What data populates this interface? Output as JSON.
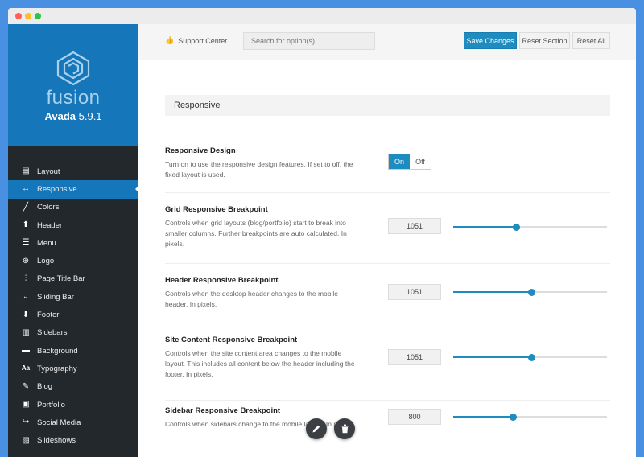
{
  "window": {
    "dots": [
      "#ff5f57",
      "#ffbd2e",
      "#28c940"
    ]
  },
  "brand": {
    "name": "fusion",
    "product": "Avada",
    "version": "5.9.1"
  },
  "sidebar": {
    "items": [
      {
        "label": "Layout",
        "icon": "layout-icon",
        "glyph": "▤",
        "active": false
      },
      {
        "label": "Responsive",
        "icon": "arrows-horizontal-icon",
        "glyph": "↔",
        "active": true
      },
      {
        "label": "Colors",
        "icon": "brush-icon",
        "glyph": "╱",
        "active": false
      },
      {
        "label": "Header",
        "icon": "arrow-up-icon",
        "glyph": "⬆",
        "active": false
      },
      {
        "label": "Menu",
        "icon": "menu-icon",
        "glyph": "☰",
        "active": false
      },
      {
        "label": "Logo",
        "icon": "plus-circle-icon",
        "glyph": "⊕",
        "active": false
      },
      {
        "label": "Page Title Bar",
        "icon": "sliders-icon",
        "glyph": "⫶",
        "active": false
      },
      {
        "label": "Sliding Bar",
        "icon": "chevron-down-icon",
        "glyph": "⌄",
        "active": false
      },
      {
        "label": "Footer",
        "icon": "arrow-down-icon",
        "glyph": "⬇",
        "active": false
      },
      {
        "label": "Sidebars",
        "icon": "sidebars-icon",
        "glyph": "▥",
        "active": false
      },
      {
        "label": "Background",
        "icon": "background-icon",
        "glyph": "▬",
        "active": false
      },
      {
        "label": "Typography",
        "icon": "typography-icon",
        "glyph": "Aa",
        "active": false
      },
      {
        "label": "Blog",
        "icon": "edit-icon",
        "glyph": "✎",
        "active": false
      },
      {
        "label": "Portfolio",
        "icon": "portfolio-icon",
        "glyph": "▣",
        "active": false
      },
      {
        "label": "Social Media",
        "icon": "share-icon",
        "glyph": "↪",
        "active": false
      },
      {
        "label": "Slideshows",
        "icon": "image-icon",
        "glyph": "▨",
        "active": false
      }
    ]
  },
  "toolbar": {
    "support_label": "Support Center",
    "search_placeholder": "Search for option(s)",
    "save_label": "Save Changes",
    "reset_section_label": "Reset Section",
    "reset_all_label": "Reset All"
  },
  "section": {
    "title": "Responsive"
  },
  "options": [
    {
      "title": "Responsive Design",
      "desc": "Turn on to use the responsive design features. If set to off, the fixed layout is used.",
      "control": "toggle",
      "on_label": "On",
      "off_label": "Off",
      "value": "On"
    },
    {
      "title": "Grid Responsive Breakpoint",
      "desc": "Controls when grid layouts (blog/portfolio) start to break into smaller columns. Further breakpoints are auto calculated. In pixels.",
      "control": "slider",
      "value": "1051",
      "fraction": 0.41
    },
    {
      "title": "Header Responsive Breakpoint",
      "desc": "Controls when the desktop header changes to the mobile header. In pixels.",
      "control": "slider",
      "value": "1051",
      "fraction": 0.51
    },
    {
      "title": "Site Content Responsive Breakpoint",
      "desc": "Controls when the site content area changes to the mobile layout. This includes all content below the header including the footer. In pixels.",
      "control": "slider",
      "value": "1051",
      "fraction": 0.51
    },
    {
      "title": "Sidebar Responsive Breakpoint",
      "desc": "Controls when sidebars change to the mobile layout. In pixels.",
      "control": "slider",
      "value": "800",
      "fraction": 0.39
    }
  ],
  "colors": {
    "accent": "#1e8cbe",
    "brand_bg": "#1576ba",
    "sidebar_bg": "#23282d",
    "page_bg": "#4a90e2"
  }
}
